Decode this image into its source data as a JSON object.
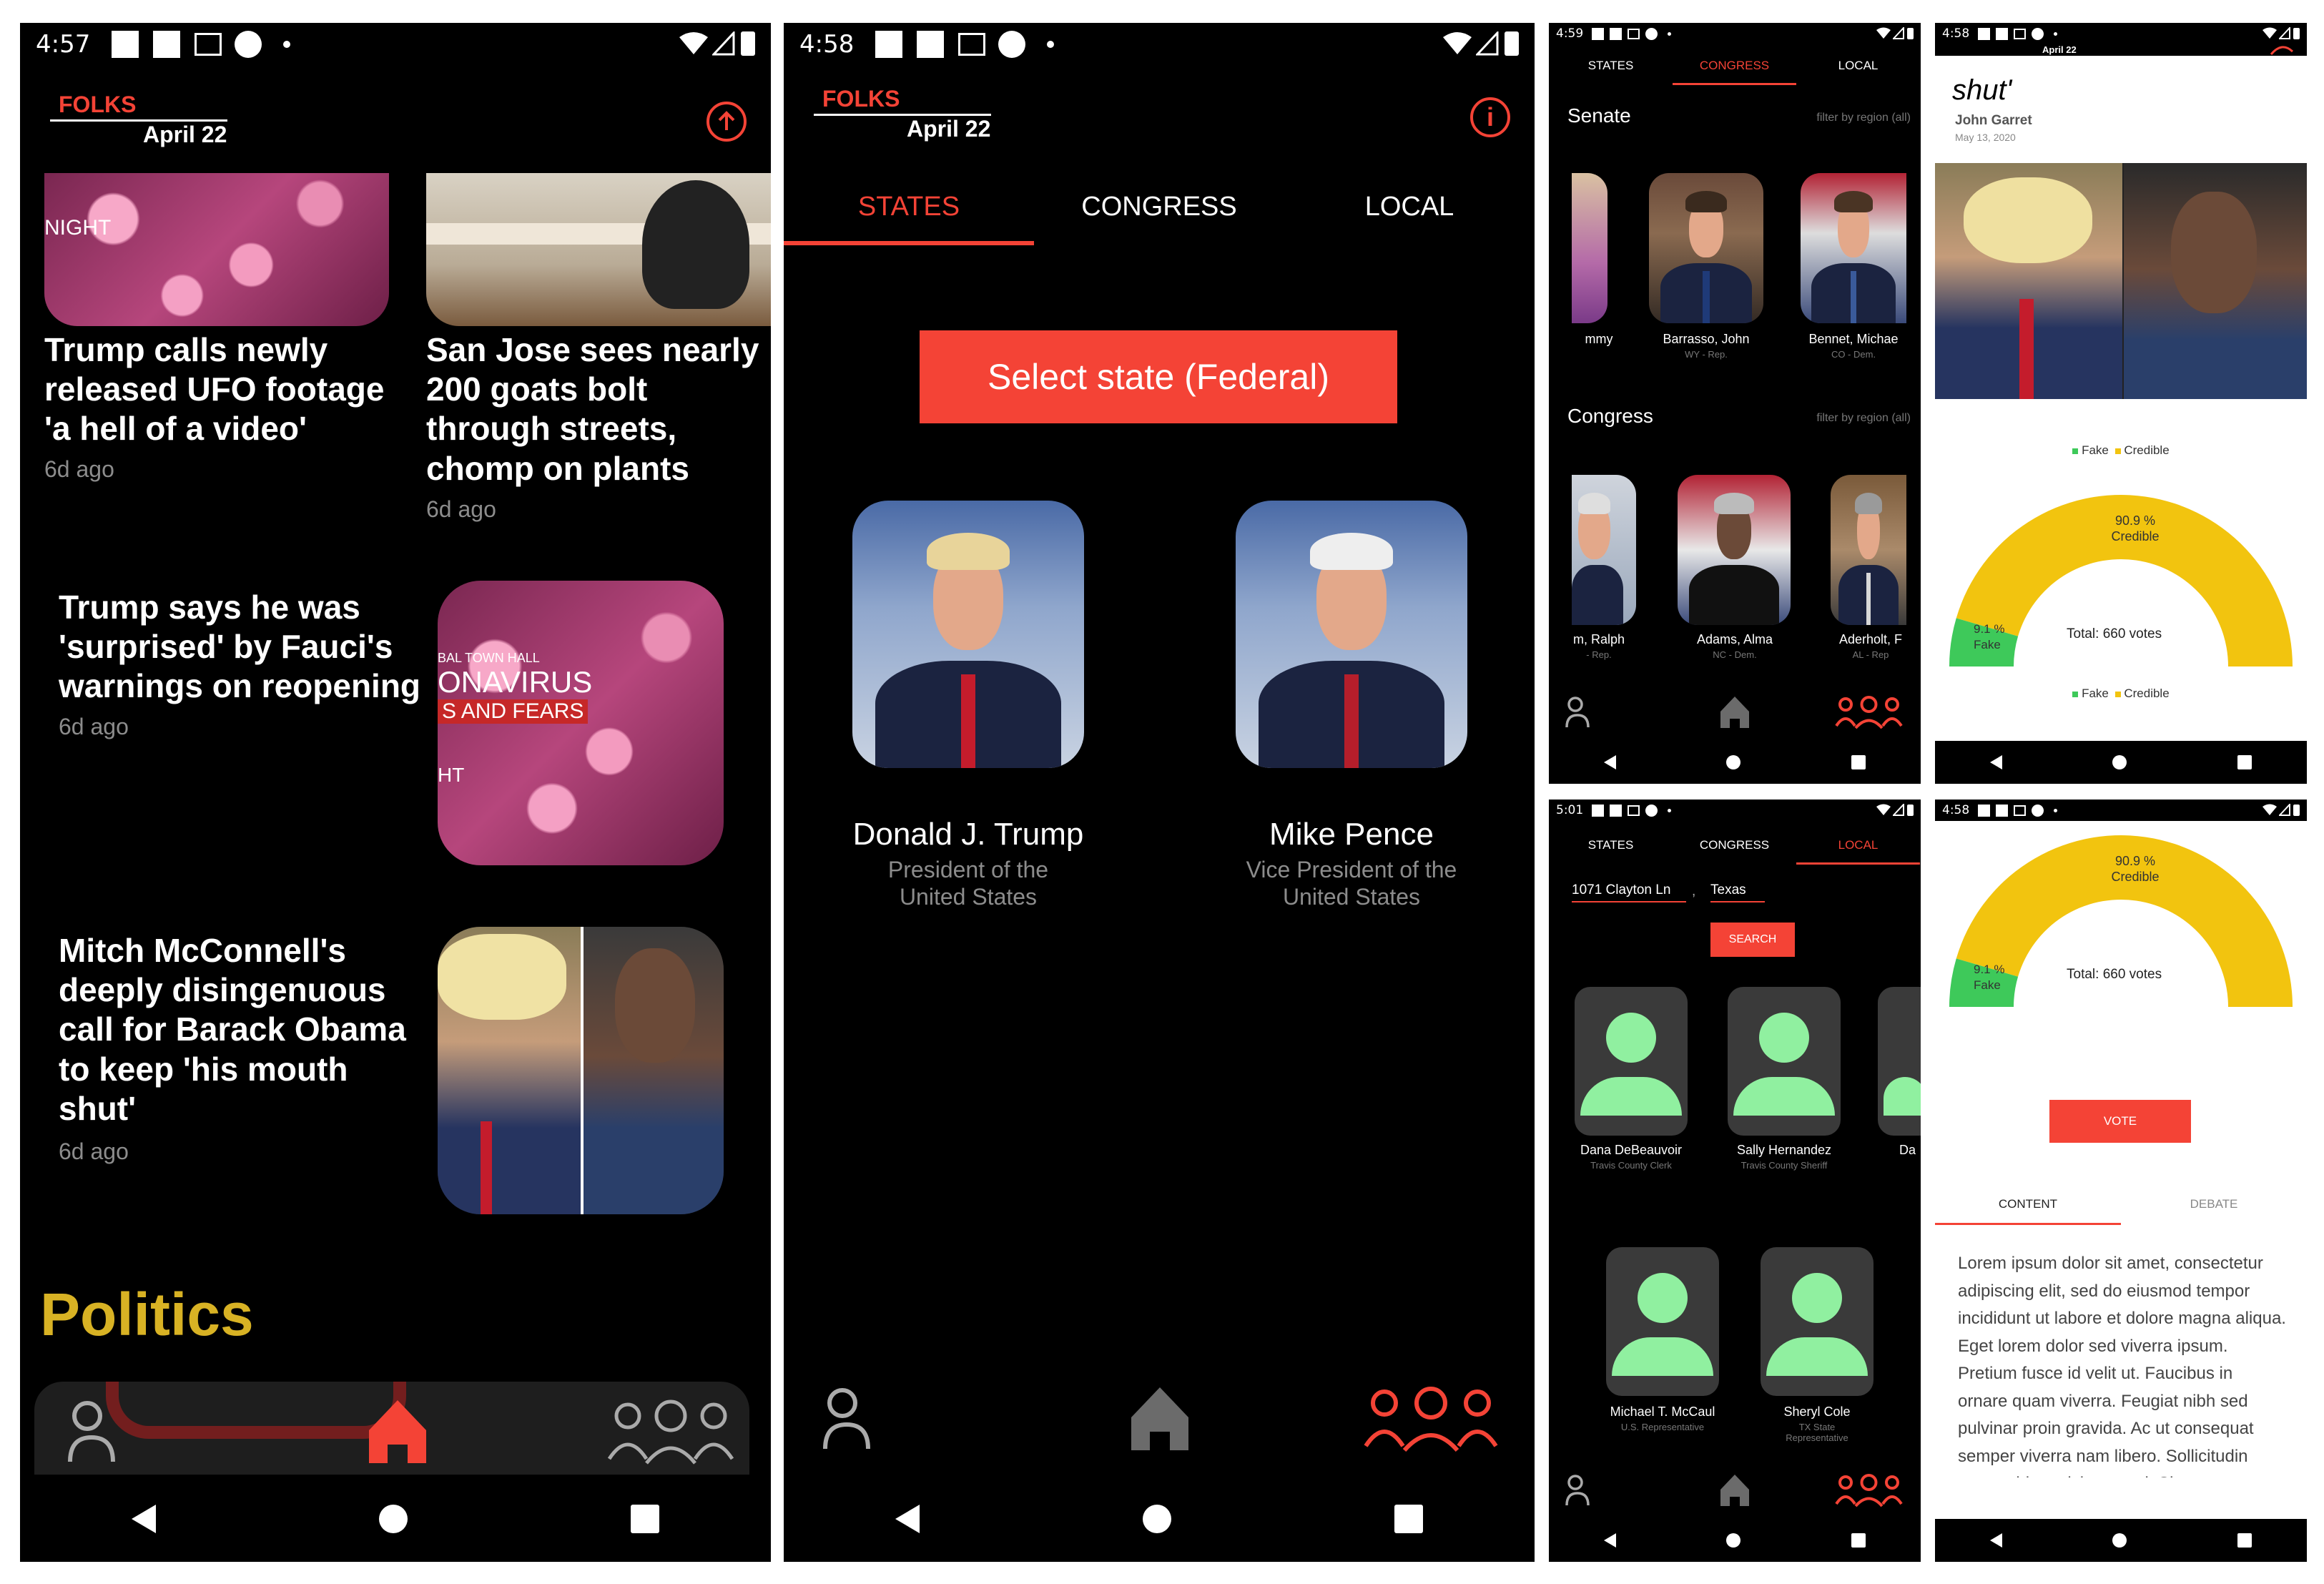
{
  "panel1": {
    "status": {
      "time": "4:57"
    },
    "brand": "FOLKS",
    "date": "April 22",
    "cards": [
      {
        "title": "Trump calls newly released UFO footage 'a hell of a video'",
        "ago": "6d ago",
        "thumb_text": "NIGHT"
      },
      {
        "title": "San Jose sees nearly 200 goats bolt through streets, chomp on plants",
        "ago": "6d ago"
      }
    ],
    "list": [
      {
        "title": "Trump says he was 'surprised' by Fauci's warnings on reopening",
        "ago": "6d ago",
        "thumb_lines": [
          "BAL TOWN HALL",
          "ONAVIRUS",
          "S AND FEARS",
          "HT"
        ]
      },
      {
        "title": "Mitch McConnell's deeply disingenuous call for Barack Obama to keep 'his mouth shut'",
        "ago": "6d ago"
      }
    ],
    "section": "Politics"
  },
  "panel2": {
    "status": {
      "time": "4:58"
    },
    "brand": "FOLKS",
    "date": "April 22",
    "tabs": [
      "STATES",
      "CONGRESS",
      "LOCAL"
    ],
    "select_button": "Select state (Federal)",
    "people": [
      {
        "name": "Donald J. Trump",
        "role1": "President of the",
        "role2": "United States"
      },
      {
        "name": "Mike Pence",
        "role1": "Vice President of the",
        "role2": "United States"
      }
    ]
  },
  "panel3": {
    "status": {
      "time": "4:59"
    },
    "tabs": [
      "STATES",
      "CONGRESS",
      "LOCAL"
    ],
    "senate_label": "Senate",
    "filter": "filter by region (all)",
    "senators": [
      {
        "name": "mmy",
        "role": ""
      },
      {
        "name": "Barrasso, John",
        "role": "WY - Rep."
      },
      {
        "name": "Bennet, Michae",
        "role": "CO - Dem."
      }
    ],
    "congress_label": "Congress",
    "reps": [
      {
        "name": "m, Ralph",
        "role": "- Rep."
      },
      {
        "name": "Adams, Alma",
        "role": "NC - Dem."
      },
      {
        "name": "Aderholt, F",
        "role": "AL - Rep"
      }
    ]
  },
  "panel4": {
    "status": {
      "time": "4:58"
    },
    "date": "April 22",
    "title_text": "shut'",
    "author": "John Garret",
    "pubdate": "May 13, 2020",
    "legend": {
      "fake": "Fake",
      "credible": "Credible"
    },
    "gauge": {
      "credible_pct": "90.9 %",
      "credible_label": "Credible",
      "fake_pct": "9.1 %",
      "fake_label": "Fake",
      "total": "Total: 660 votes"
    },
    "colors": {
      "credible": "#f2c40f",
      "fake": "#3ec95a"
    }
  },
  "panel5": {
    "status": {
      "time": "5:01"
    },
    "tabs": [
      "STATES",
      "CONGRESS",
      "LOCAL"
    ],
    "address": "1071 Clayton Ln",
    "state": "Texas",
    "search": "SEARCH",
    "officials": [
      {
        "name": "Dana DeBeauvoir",
        "role": "Travis County Clerk"
      },
      {
        "name": "Sally Hernandez",
        "role": "Travis County Sheriff"
      },
      {
        "name": "Da",
        "role": ""
      },
      {
        "name": "Michael T. McCaul",
        "role": "U.S. Representative"
      },
      {
        "name": "Sheryl Cole",
        "role": "TX State Representative"
      }
    ]
  },
  "panel6": {
    "status": {
      "time": "4:58"
    },
    "gauge": {
      "credible_pct": "90.9 %",
      "credible_label": "Credible",
      "fake_pct": "9.1 %",
      "fake_label": "Fake",
      "total": "Total: 660 votes"
    },
    "vote": "VOTE",
    "tabs": [
      "CONTENT",
      "DEBATE"
    ],
    "body": "Lorem ipsum dolor sit amet, consectetur adipiscing elit, sed do eiusmod tempor incididunt ut labore et dolore magna aliqua. Eget lorem dolor sed viverra ipsum. Pretium fusce id velit ut. Faucibus in ornare quam viverra. Feugiat nibh sed pulvinar proin gravida. Ac ut consequat semper viverra nam libero. Sollicitudin tempor id eu nisl nunc mi. Sit amet cursus"
  }
}
